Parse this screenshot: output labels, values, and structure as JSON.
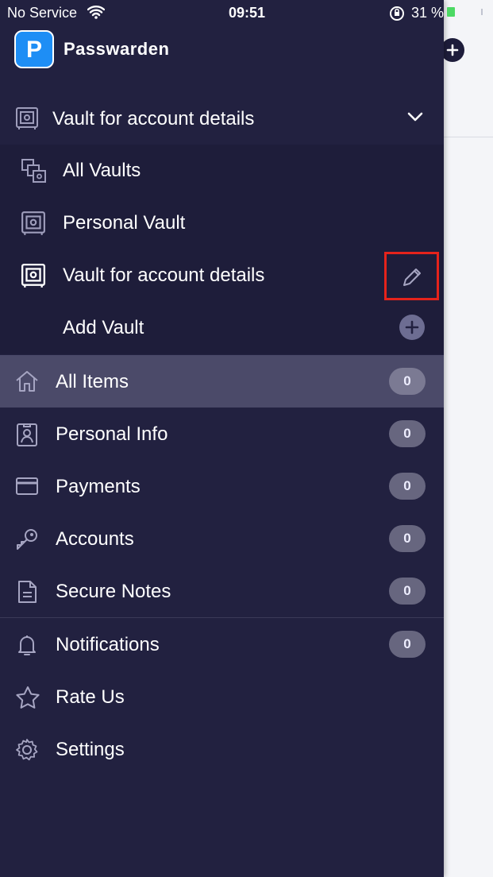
{
  "status_bar": {
    "carrier": "No Service",
    "time": "09:51",
    "battery": "31 %"
  },
  "app": {
    "name": "Passwarden",
    "logo_letter": "P"
  },
  "vault_selector": {
    "label": "Vault for account details"
  },
  "vaults": [
    {
      "label": "All Vaults",
      "icon": "all-vaults-icon"
    },
    {
      "label": "Personal Vault",
      "icon": "vault-icon"
    },
    {
      "label": "Vault for account details",
      "icon": "vault-icon"
    },
    {
      "label": "Add Vault",
      "icon": "add-icon"
    }
  ],
  "menu": [
    {
      "label": "All Items",
      "count": "0",
      "icon": "home-icon",
      "active": true
    },
    {
      "label": "Personal Info",
      "count": "0",
      "icon": "id-card-icon"
    },
    {
      "label": "Payments",
      "count": "0",
      "icon": "credit-card-icon"
    },
    {
      "label": "Accounts",
      "count": "0",
      "icon": "key-icon"
    },
    {
      "label": "Secure Notes",
      "count": "0",
      "icon": "note-icon"
    },
    {
      "label": "Notifications",
      "count": "0",
      "icon": "bell-icon"
    },
    {
      "label": "Rate Us",
      "icon": "star-icon"
    },
    {
      "label": "Settings",
      "icon": "gear-icon"
    }
  ],
  "colors": {
    "drawer_bg": "#222140",
    "accent_active": "#4b4a69",
    "highlight": "#e5231b",
    "logo": "#1e8ef5"
  }
}
